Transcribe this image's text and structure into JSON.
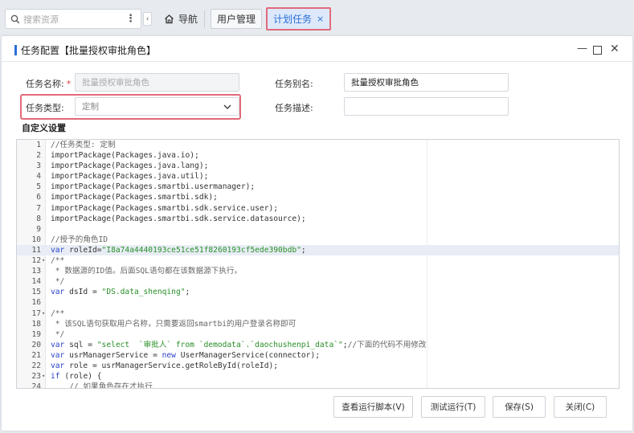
{
  "topbar": {
    "search_placeholder": "搜索资源",
    "more_label": "⋮",
    "collapse_label": "‹",
    "home_tab": "导航",
    "users_tab": "用户管理",
    "sched_tab": "计划任务",
    "sched_close": "×"
  },
  "dialog": {
    "title": "任务配置【批量授权审批角色】",
    "min_label": "—",
    "close_label": "✕"
  },
  "form": {
    "name_label": "任务名称:",
    "name_required": "*",
    "name_placeholder": "批量授权审批角色",
    "alias_label": "任务别名:",
    "alias_value": "批量授权审批角色",
    "type_label": "任务类型:",
    "type_value": "定制",
    "desc_label": "任务描述:",
    "desc_value": "",
    "custom_section": "自定义设置"
  },
  "code_lines": [
    {
      "n": "1",
      "fold": "",
      "t": "//任务类型: 定制",
      "c": "cm"
    },
    {
      "n": "2",
      "fold": "",
      "t": "importPackage(Packages.java.io);",
      "c": ""
    },
    {
      "n": "3",
      "fold": "",
      "t": "importPackage(Packages.java.lang);",
      "c": ""
    },
    {
      "n": "4",
      "fold": "",
      "t": "importPackage(Packages.java.util);",
      "c": ""
    },
    {
      "n": "5",
      "fold": "",
      "t": "importPackage(Packages.smartbi.usermanager);",
      "c": ""
    },
    {
      "n": "6",
      "fold": "",
      "t": "importPackage(Packages.smartbi.sdk);",
      "c": ""
    },
    {
      "n": "7",
      "fold": "",
      "t": "importPackage(Packages.smartbi.sdk.service.user);",
      "c": ""
    },
    {
      "n": "8",
      "fold": "",
      "t": "importPackage(Packages.smartbi.sdk.service.datasource);",
      "c": ""
    },
    {
      "n": "9",
      "fold": "",
      "t": "",
      "c": ""
    },
    {
      "n": "10",
      "fold": "",
      "t": "//授予的角色ID",
      "c": "cm"
    },
    {
      "n": "11",
      "fold": "",
      "t": "var roleId=\"I8a74a4440193ce51ce51f8260193cf5ede390bdb\";",
      "c": "",
      "active": true
    },
    {
      "n": "12",
      "fold": "▾",
      "t": "/**",
      "c": "cm"
    },
    {
      "n": "13",
      "fold": "",
      "t": " * 数据源的ID值。后面SQL语句都在该数据源下执行。",
      "c": "cm"
    },
    {
      "n": "14",
      "fold": "",
      "t": " */",
      "c": "cm"
    },
    {
      "n": "15",
      "fold": "",
      "t": "var dsId = \"DS.data_shenqing\";",
      "c": ""
    },
    {
      "n": "16",
      "fold": "",
      "t": "",
      "c": ""
    },
    {
      "n": "17",
      "fold": "▾",
      "t": "/**",
      "c": "cm"
    },
    {
      "n": "18",
      "fold": "",
      "t": " * 该SQL语句获取用户名称，只需要返回smartbi的用户登录名称即可",
      "c": "cm"
    },
    {
      "n": "19",
      "fold": "",
      "t": " */",
      "c": "cm"
    },
    {
      "n": "20",
      "fold": "",
      "t": "var sql = \"select  `审批人` from `demodata`.`daochushenpi_data`\";//下面的代码不用修改",
      "c": ""
    },
    {
      "n": "21",
      "fold": "",
      "t": "var usrManagerService = new UserManagerService(connector);",
      "c": ""
    },
    {
      "n": "22",
      "fold": "",
      "t": "var role = usrManagerService.getRoleById(roleId);",
      "c": ""
    },
    {
      "n": "23",
      "fold": "▾",
      "t": "if (role) {",
      "c": ""
    },
    {
      "n": "24",
      "fold": "",
      "t": "    // 如果角色存在才执行",
      "c": "cm"
    }
  ],
  "buttons": {
    "view_script": "查看运行脚本(V)",
    "test_run": "测试运行(T)",
    "save": "保存(S)",
    "close": "关闭(C)"
  }
}
